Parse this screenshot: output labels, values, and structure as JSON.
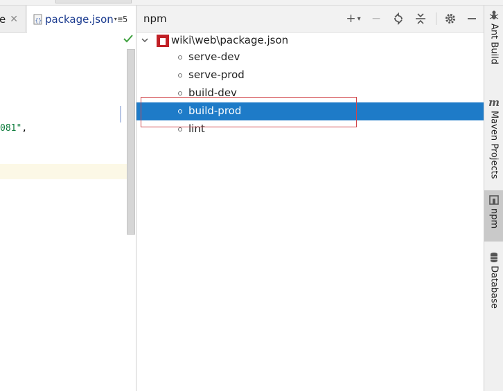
{
  "editor": {
    "tabs": [
      {
        "label": "e"
      },
      {
        "label": "package.json",
        "more": "≡5"
      }
    ],
    "code_snippet": "081\"",
    "code_comma": ","
  },
  "npm": {
    "title": "npm",
    "toolbar": {
      "add": "+",
      "add_caret": "▾",
      "remove": "−"
    },
    "tree": {
      "root_label": "wiki\\web\\package.json",
      "scripts": [
        {
          "label": "serve-dev",
          "selected": false
        },
        {
          "label": "serve-prod",
          "selected": false
        },
        {
          "label": "build-dev",
          "selected": false
        },
        {
          "label": "build-prod",
          "selected": true
        },
        {
          "label": "lint",
          "selected": false
        }
      ]
    }
  },
  "tool_stripe": {
    "items": [
      {
        "label": "Ant Build",
        "icon": "ant-icon"
      },
      {
        "label": "Maven Projects",
        "icon": "maven-icon"
      },
      {
        "label": "npm",
        "icon": "npm-panel-icon",
        "active": true
      },
      {
        "label": "Database",
        "icon": "database-icon"
      }
    ]
  },
  "colors": {
    "selection": "#1e7bc8",
    "npm_brand": "#c12127",
    "annotation": "#d0454a"
  }
}
